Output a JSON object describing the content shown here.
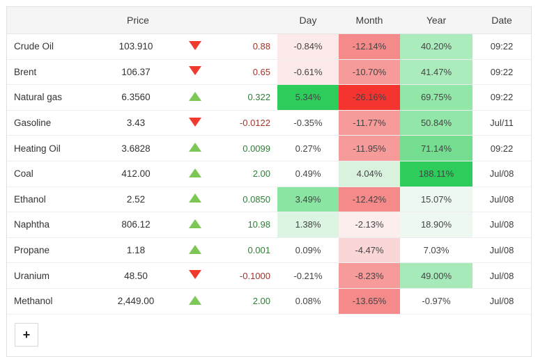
{
  "panel": {
    "add_button_label": "+",
    "add_button_icon": "plus-icon"
  },
  "colors": {
    "header_bg": "#f5f5f5",
    "border": "#e2e2e2",
    "row_border": "#eeeeee",
    "text": "#333333",
    "up_text": "#2f7d36",
    "down_text": "#a3332b",
    "arrow_up": "#7cc756",
    "arrow_down": "#ef3b2d",
    "heat_green_strong": "#2ecc5a",
    "heat_green_mid": "#6fdd8b",
    "heat_green_light": "#abecbd",
    "heat_green_faint": "#d9f4e0",
    "heat_green_trace": "#eef9f1",
    "heat_red_strong": "#f5332f",
    "heat_red_mid": "#f58a8a",
    "heat_red_light": "#f9b9b9",
    "heat_red_faint": "#fce9e9",
    "heat_red_trace": "#fdf2f2",
    "neutral": "#ffffff"
  },
  "table": {
    "columns": [
      {
        "key": "name",
        "label": "",
        "align": "left"
      },
      {
        "key": "price",
        "label": "Price",
        "align": "center"
      },
      {
        "key": "arrow",
        "label": "",
        "align": "center"
      },
      {
        "key": "chg",
        "label": "",
        "align": "right"
      },
      {
        "key": "day",
        "label": "Day",
        "align": "center"
      },
      {
        "key": "month",
        "label": "Month",
        "align": "center"
      },
      {
        "key": "year",
        "label": "Year",
        "align": "center"
      },
      {
        "key": "date",
        "label": "Date",
        "align": "center"
      }
    ],
    "rows": [
      {
        "name": "Crude Oil",
        "price": "103.910",
        "direction": "down",
        "change": "0.88",
        "day": "-0.84%",
        "month": "-12.14%",
        "year": "40.20%",
        "date": "09:22",
        "day_bg": "#fce9e9",
        "month_bg": "#f58a8a",
        "year_bg": "#abecbd",
        "day_value": -0.84,
        "month_value": -12.14,
        "year_value": 40.2
      },
      {
        "name": "Brent",
        "price": "106.37",
        "direction": "down",
        "change": "0.65",
        "day": "-0.61%",
        "month": "-10.70%",
        "year": "41.47%",
        "date": "09:22",
        "day_bg": "#fce9e9",
        "month_bg": "#f79a9a",
        "year_bg": "#abecbd",
        "day_value": -0.61,
        "month_value": -10.7,
        "year_value": 41.47
      },
      {
        "name": "Natural gas",
        "price": "6.3560",
        "direction": "up",
        "change": "0.322",
        "day": "5.34%",
        "month": "-26.16%",
        "year": "69.75%",
        "date": "09:22",
        "day_bg": "#2ecc5a",
        "month_bg": "#f5332f",
        "year_bg": "#92e6a8",
        "day_value": 5.34,
        "month_value": -26.16,
        "year_value": 69.75
      },
      {
        "name": "Gasoline",
        "price": "3.43",
        "direction": "down",
        "change": "-0.0122",
        "day": "-0.35%",
        "month": "-11.77%",
        "year": "50.84%",
        "date": "Jul/11",
        "day_bg": "#ffffff",
        "month_bg": "#f79a9a",
        "year_bg": "#92e6a8",
        "day_value": -0.35,
        "month_value": -11.77,
        "year_value": 50.84
      },
      {
        "name": "Heating Oil",
        "price": "3.6828",
        "direction": "up",
        "change": "0.0099",
        "day": "0.27%",
        "month": "-11.95%",
        "year": "71.14%",
        "date": "09:22",
        "day_bg": "#ffffff",
        "month_bg": "#f79a9a",
        "year_bg": "#74dd8f",
        "day_value": 0.27,
        "month_value": -11.95,
        "year_value": 71.14
      },
      {
        "name": "Coal",
        "price": "412.00",
        "direction": "up",
        "change": "2.00",
        "day": "0.49%",
        "month": "4.04%",
        "year": "188.11%",
        "date": "Jul/08",
        "day_bg": "#ffffff",
        "month_bg": "#d8f2de",
        "year_bg": "#2ecc5a",
        "day_value": 0.49,
        "month_value": 4.04,
        "year_value": 188.11
      },
      {
        "name": "Ethanol",
        "price": "2.52",
        "direction": "up",
        "change": "0.0850",
        "day": "3.49%",
        "month": "-12.42%",
        "year": "15.07%",
        "date": "Jul/08",
        "day_bg": "#8ae4a2",
        "month_bg": "#f58a8a",
        "year_bg": "#edf9f0",
        "day_value": 3.49,
        "month_value": -12.42,
        "year_value": 15.07
      },
      {
        "name": "Naphtha",
        "price": "806.12",
        "direction": "up",
        "change": "10.98",
        "day": "1.38%",
        "month": "-2.13%",
        "year": "18.90%",
        "date": "Jul/08",
        "day_bg": "#dcf5e2",
        "month_bg": "#fdeeee",
        "year_bg": "#edf9f0",
        "day_value": 1.38,
        "month_value": -2.13,
        "year_value": 18.9
      },
      {
        "name": "Propane",
        "price": "1.18",
        "direction": "up",
        "change": "0.001",
        "day": "0.09%",
        "month": "-4.47%",
        "year": "7.03%",
        "date": "Jul/08",
        "day_bg": "#ffffff",
        "month_bg": "#fbd6d6",
        "year_bg": "#ffffff",
        "day_value": 0.09,
        "month_value": -4.47,
        "year_value": 7.03
      },
      {
        "name": "Uranium",
        "price": "48.50",
        "direction": "down",
        "change": "-0.1000",
        "day": "-0.21%",
        "month": "-8.23%",
        "year": "49.00%",
        "date": "Jul/08",
        "day_bg": "#ffffff",
        "month_bg": "#f79a9a",
        "year_bg": "#a6eab9",
        "day_value": -0.21,
        "month_value": -8.23,
        "year_value": 49.0
      },
      {
        "name": "Methanol",
        "price": "2,449.00",
        "direction": "up",
        "change": "2.00",
        "day": "0.08%",
        "month": "-13.65%",
        "year": "-0.97%",
        "date": "Jul/08",
        "day_bg": "#ffffff",
        "month_bg": "#f58a8a",
        "year_bg": "#ffffff",
        "day_value": 0.08,
        "month_value": -13.65,
        "year_value": -0.97
      }
    ]
  }
}
